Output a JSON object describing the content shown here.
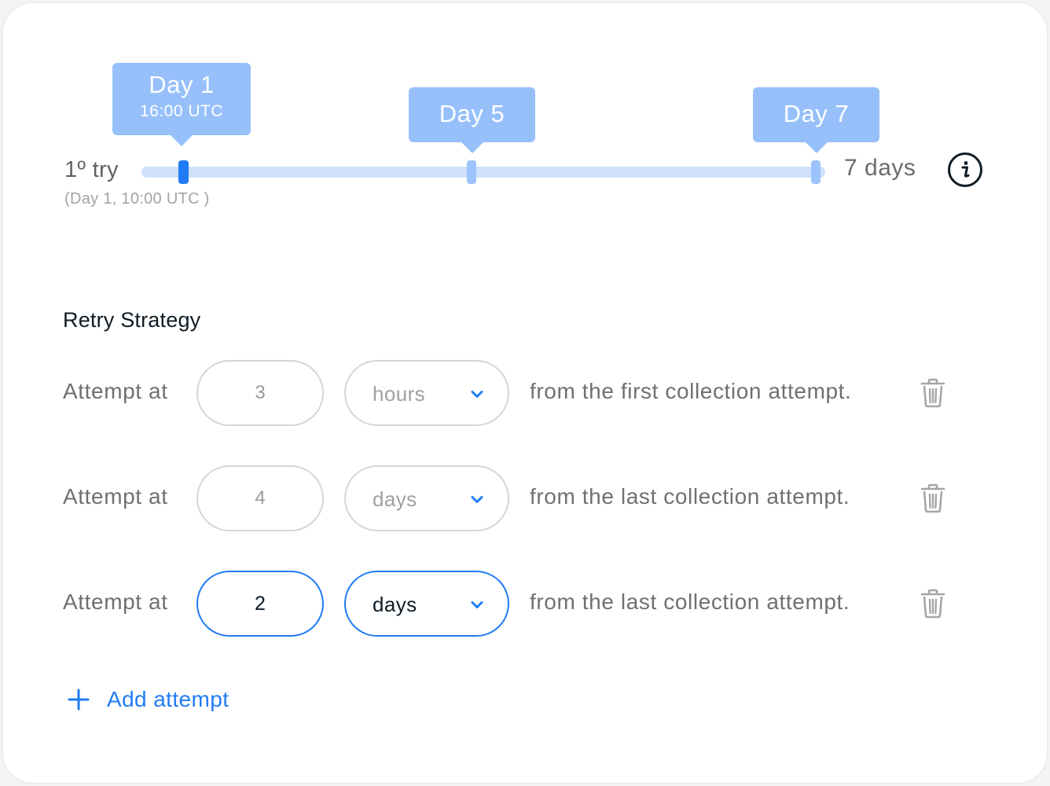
{
  "timeline": {
    "start_label": "1º try",
    "start_sub": "(Day 1, 10:00 UTC )",
    "end_label": "7 days",
    "tooltips": [
      {
        "label": "Day 1",
        "sub": "16:00 UTC",
        "active": true
      },
      {
        "label": "Day 5",
        "sub": "",
        "active": false
      },
      {
        "label": "Day 7",
        "sub": "",
        "active": false
      }
    ],
    "track_color": "#cfe1fb",
    "active_marker_color": "#1f7cf4",
    "tooltip_color": "#97c0fb",
    "info_icon": "info-icon"
  },
  "retry": {
    "title": "Retry Strategy",
    "rows": [
      {
        "prefix": "Attempt at",
        "value": "3",
        "unit": "hours",
        "suffix": "from the first collection attempt.",
        "focused": false
      },
      {
        "prefix": "Attempt at",
        "value": "4",
        "unit": "days",
        "suffix": "from the last collection attempt.",
        "focused": false
      },
      {
        "prefix": "Attempt at",
        "value": "2",
        "unit": "days",
        "suffix": "from the last collection attempt.",
        "focused": true
      }
    ],
    "add_label": "Add attempt",
    "accent": "#1f7cf4",
    "delete_icon": "trash-icon",
    "dropdown_icon": "chevron-down-icon",
    "add_icon": "plus-icon"
  }
}
